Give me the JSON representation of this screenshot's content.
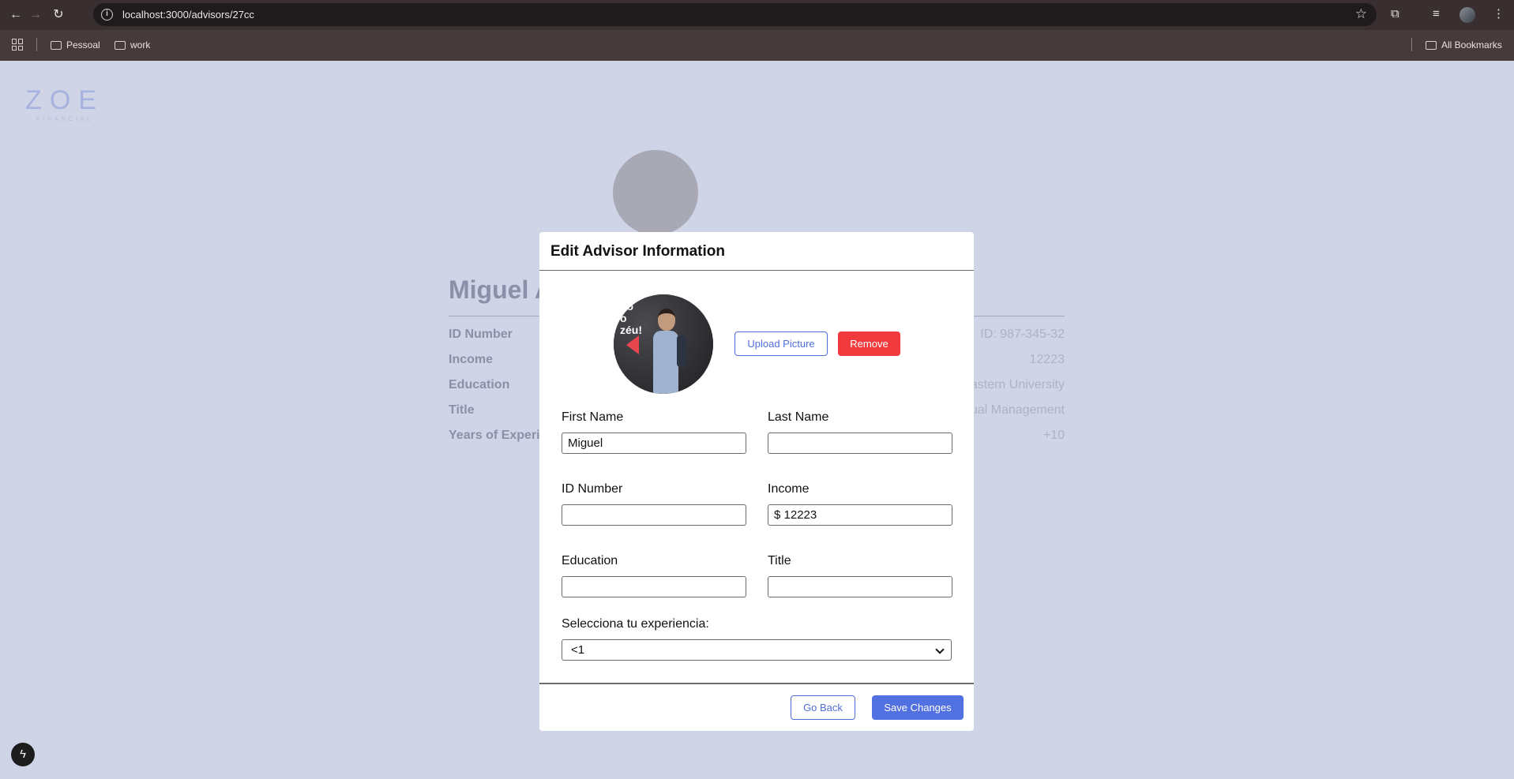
{
  "browser": {
    "url": "localhost:3000/advisors/27cc",
    "bookmarks": [
      {
        "label": "Pessoal",
        "icon": "folder-icon"
      },
      {
        "label": "work",
        "icon": "folder-icon"
      }
    ],
    "all_bookmarks": "All Bookmarks"
  },
  "logo": {
    "word": "ZOE",
    "sub": "FINANCIAL"
  },
  "background": {
    "name": "Miguel A",
    "rows": [
      {
        "label": "ID Number",
        "value": "ID: 987-345-32"
      },
      {
        "label": "Income",
        "value": "12223"
      },
      {
        "label": "Education",
        "value": "astern University"
      },
      {
        "label": "Title",
        "value": "ual Management"
      },
      {
        "label": "Years of Experi",
        "value": "+10"
      }
    ]
  },
  "modal": {
    "title": "Edit Advisor Information",
    "photo_text": "no\no\nzéu!",
    "upload_label": "Upload Picture",
    "remove_label": "Remove",
    "fields": {
      "first_name": {
        "label": "First Name",
        "value": "Miguel"
      },
      "last_name": {
        "label": "Last Name",
        "value": ""
      },
      "id_number": {
        "label": "ID Number",
        "value": ""
      },
      "income": {
        "label": "Income",
        "value": "$ 12223"
      },
      "education": {
        "label": "Education",
        "value": ""
      },
      "title": {
        "label": "Title",
        "value": ""
      }
    },
    "experience": {
      "label": "Selecciona tu experiencia:",
      "selected": "<1"
    },
    "go_back_label": "Go Back",
    "save_label": "Save Changes"
  },
  "colors": {
    "accent": "#5271e0",
    "danger": "#f03a3e",
    "page_bg": "#d0d4e7"
  }
}
